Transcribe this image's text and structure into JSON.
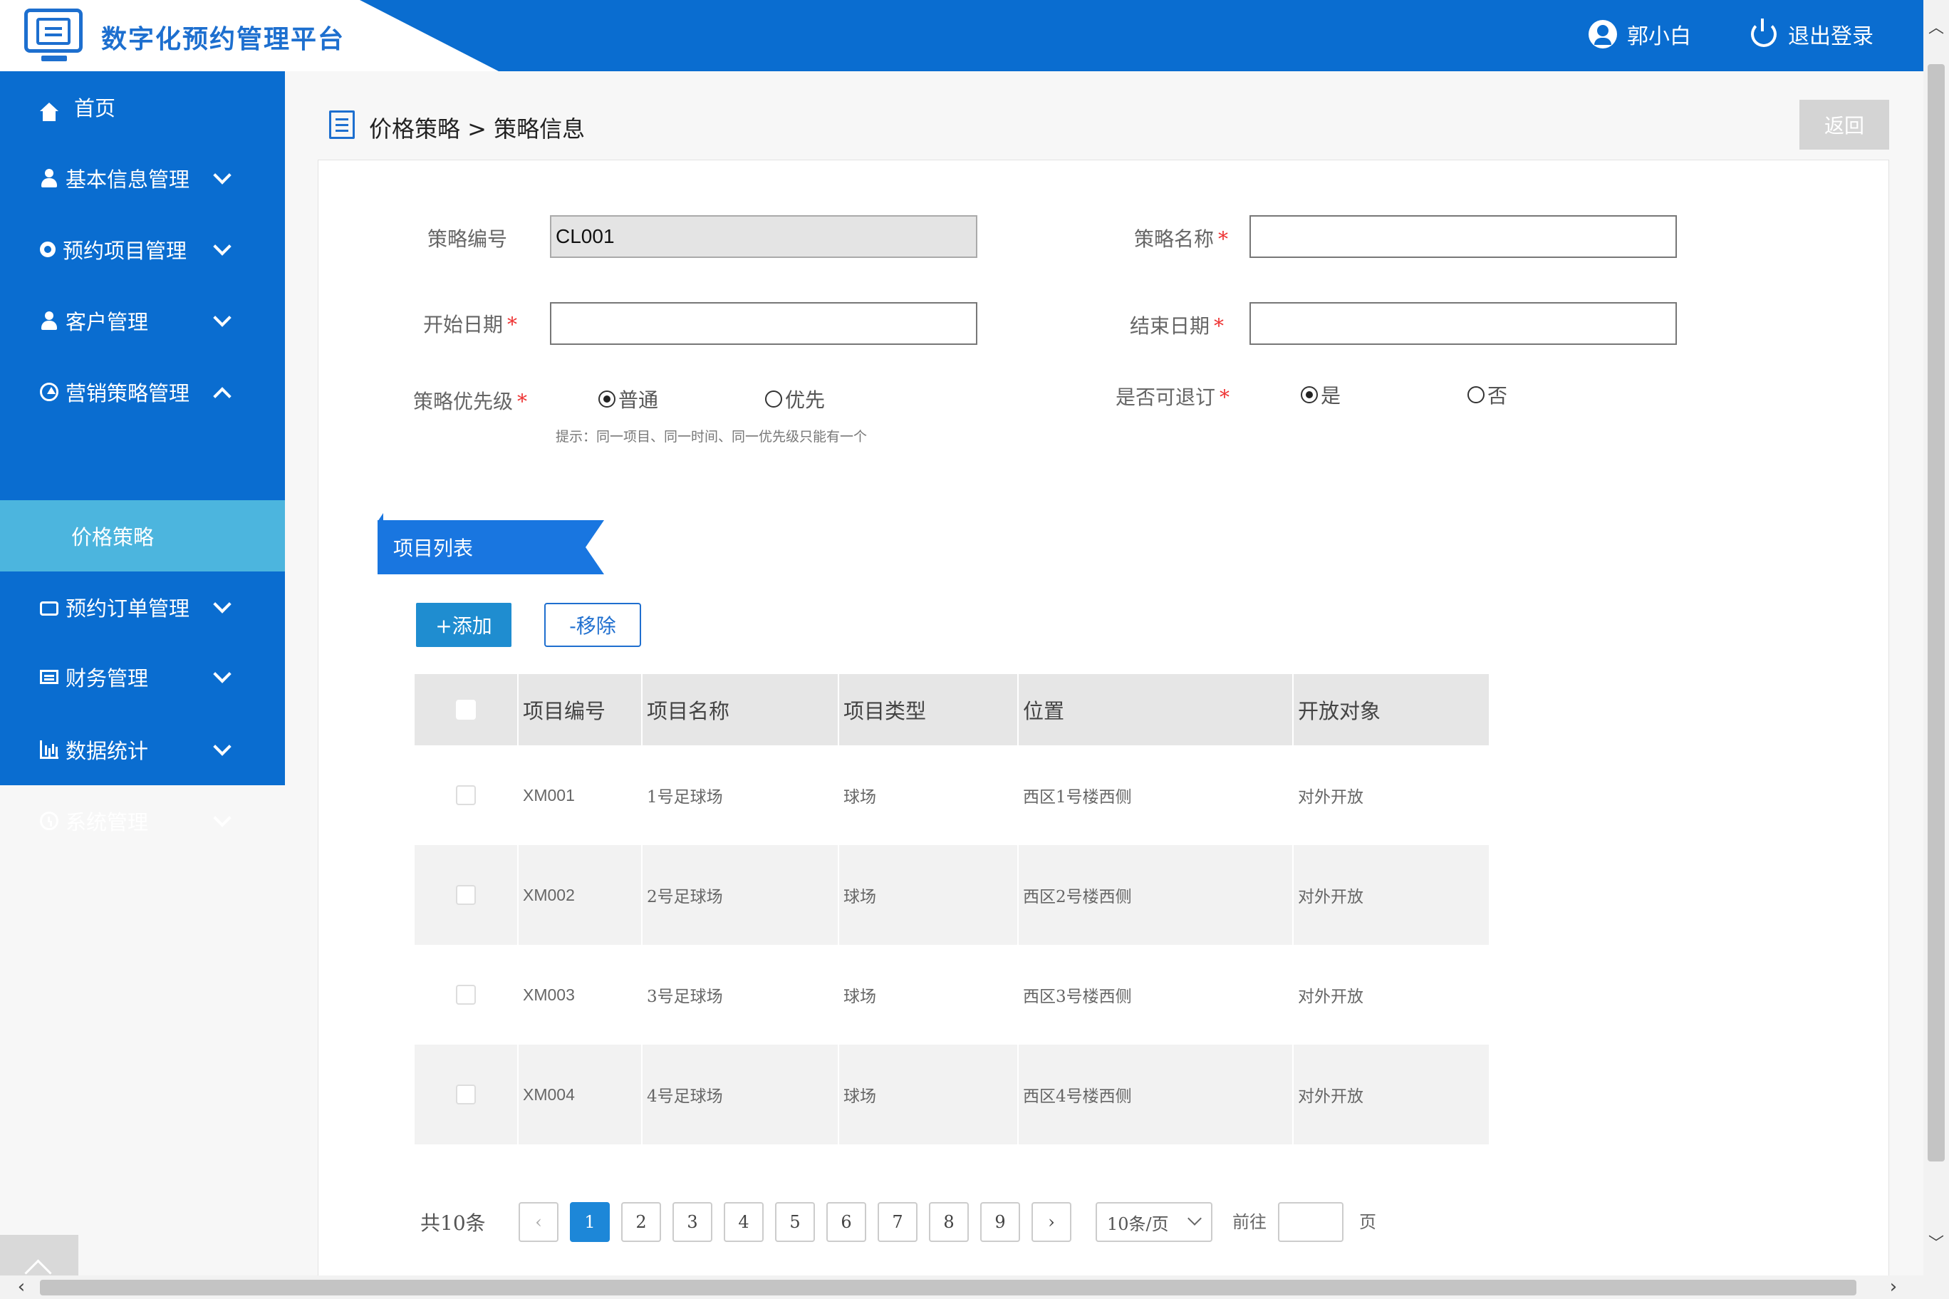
{
  "app": {
    "title": "数字化预约管理平台"
  },
  "header": {
    "user_name": "郭小白",
    "logout_label": "退出登录"
  },
  "sidebar": {
    "items": [
      {
        "label": "首页",
        "icon": "home-icon"
      },
      {
        "label": "基本信息管理",
        "icon": "user-icon"
      },
      {
        "label": "预约项目管理",
        "icon": "gears-icon"
      },
      {
        "label": "客户管理",
        "icon": "user-icon"
      },
      {
        "label": "营销策略管理",
        "icon": "arrow-circle-up-icon",
        "expanded": true
      },
      {
        "label": "预约订单管理",
        "icon": "inbox-icon"
      },
      {
        "label": "财务管理",
        "icon": "id-card-icon"
      },
      {
        "label": "数据统计",
        "icon": "bar-chart-icon"
      },
      {
        "label": "系统管理",
        "icon": "clock-icon"
      }
    ],
    "sub_active": "价格策略"
  },
  "breadcrumb": {
    "text": "价格策略 > 策略信息"
  },
  "back_label": "返回",
  "form": {
    "code_label": "策略编号",
    "code_value": "CL001",
    "name_label": "策略名称",
    "name_value": "",
    "start_label": "开始日期",
    "start_value": "",
    "end_label": "结束日期",
    "end_value": "",
    "priority_label": "策略优先级",
    "priority_options": [
      "普通",
      "优先"
    ],
    "priority_selected": "普通",
    "priority_hint": "提示：同一项目、同一时间、同一优先级只能有一个",
    "refund_label": "是否可退订",
    "refund_options": [
      "是",
      "否"
    ],
    "refund_selected": "是",
    "required_mark": "*"
  },
  "section": {
    "title": "项目列表",
    "add_label": "+添加",
    "remove_label": "-移除"
  },
  "table": {
    "headers": [
      "项目编号",
      "项目名称",
      "项目类型",
      "位置",
      "开放对象"
    ],
    "rows": [
      [
        "XM001",
        "1号足球场",
        "球场",
        "西区1号楼西侧",
        "对外开放"
      ],
      [
        "XM002",
        "2号足球场",
        "球场",
        "西区2号楼西侧",
        "对外开放"
      ],
      [
        "XM003",
        "3号足球场",
        "球场",
        "西区3号楼西侧",
        "对外开放"
      ],
      [
        "XM004",
        "4号足球场",
        "球场",
        "西区4号楼西侧",
        "对外开放"
      ]
    ]
  },
  "pagination": {
    "total": "共10条",
    "prev": "‹",
    "next": "›",
    "pages": [
      "1",
      "2",
      "3",
      "4",
      "5",
      "6",
      "7",
      "8",
      "9"
    ],
    "current": "1",
    "page_size": "10条/页",
    "goto_label": "前往",
    "page_unit": "页"
  },
  "colors": {
    "primary": "#0a6dd0",
    "active_sub": "#4cb5de",
    "accent_btn": "#1f8dd0",
    "required": "#ee3333"
  }
}
